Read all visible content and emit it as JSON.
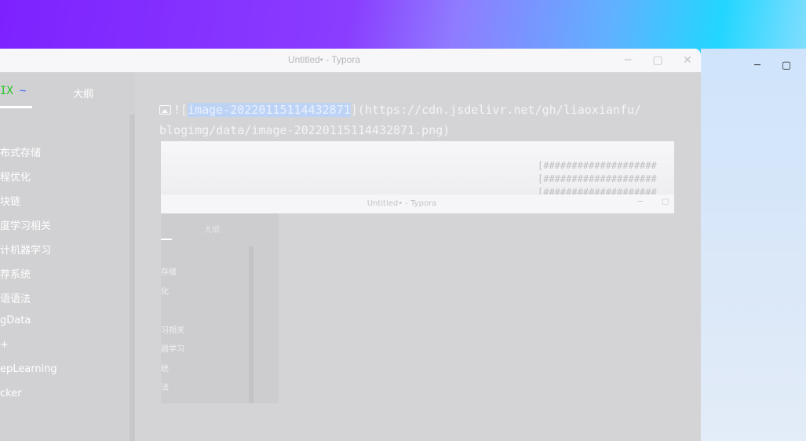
{
  "window": {
    "title": "Untitled• - Typora",
    "buttons": {
      "minimize": "─",
      "maximize": "▢",
      "close": "✕"
    }
  },
  "background_window": {
    "buttons": {
      "minimize": "─",
      "maximize": "▢"
    }
  },
  "sidebar": {
    "tab_files": "IX",
    "tab_files_suffix": "~",
    "tab_outline": "大纲",
    "items": [
      {
        "label": "布式存储"
      },
      {
        "label": "程优化"
      },
      {
        "label": "块链"
      },
      {
        "label": "度学习相关"
      },
      {
        "label": "计机器学习"
      },
      {
        "label": "荐系统"
      },
      {
        "label": "语语法"
      },
      {
        "label": "gData"
      },
      {
        "label": "+"
      },
      {
        "label": "epLearning"
      },
      {
        "label": "cker"
      }
    ]
  },
  "editor": {
    "line1_prefix": "![",
    "line1_selected": "image-20220115114432871",
    "line1_suffix": "](https://cdn.jsdelivr.net/gh/liaoxianfu/",
    "line2": "blogimg/data/image-20220115114432871.png)"
  },
  "preview": {
    "terminal_lines": [
      "[####################",
      "[####################",
      "[####################"
    ],
    "title": "Untitled• - Typora",
    "btn_min": "─",
    "btn_max": "▢",
    "outline": "大纲",
    "items": [
      {
        "label": "存储"
      },
      {
        "label": "化"
      },
      {
        "label": "习相关"
      },
      {
        "label": "器学习"
      },
      {
        "label": "统"
      },
      {
        "label": "法"
      }
    ]
  },
  "colors": {
    "selection": "#bdd3f6",
    "accent_green": "#26c626",
    "accent_blue": "#4a6cff"
  }
}
